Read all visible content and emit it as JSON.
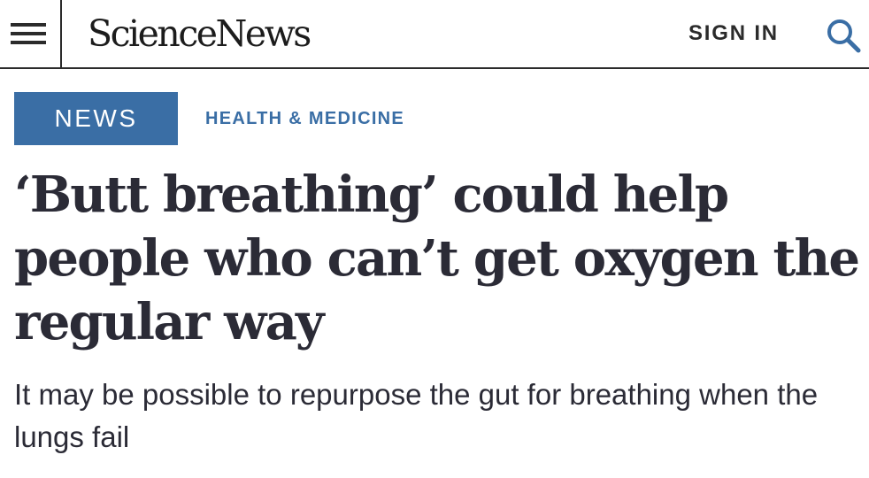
{
  "header": {
    "menu_icon": "hamburger-menu-icon",
    "logo_text": "ScienceNews",
    "sign_in_label": "SIGN IN",
    "search_icon": "search-icon"
  },
  "article": {
    "type_label": "NEWS",
    "category_label": "HEALTH & MEDICINE",
    "headline": "‘Butt breathing’ could help people who can’t get oxygen the regular way",
    "dek": "It may be possible to repurpose the gut for breathing when the lungs fail"
  },
  "colors": {
    "accent": "#3a6ea5",
    "text": "#2b2b36",
    "rule": "#2b2b2b"
  }
}
